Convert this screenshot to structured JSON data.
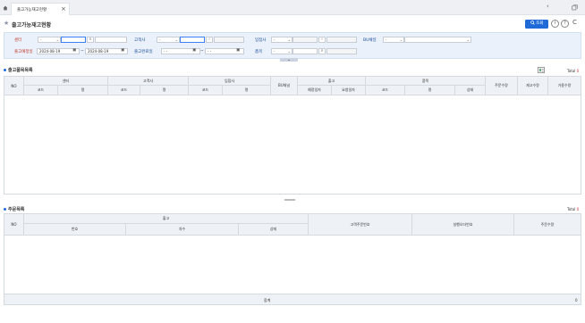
{
  "tabs": [
    {
      "label": "출고가능재고현황"
    }
  ],
  "page": {
    "title": "출고가능재고현황",
    "search_button": "조회",
    "info_icon": "i",
    "help_icon": "?",
    "refresh_icon": "C"
  },
  "search": {
    "center_label": "센터",
    "customer_label": "고객사",
    "owner_label": "입점사",
    "bu_channel_label": "BU채널",
    "ship_plan_date_label": "출고예정일",
    "ship_complete_date_label": "출고완료일",
    "item_label": "품목",
    "select_default": "-",
    "date_from": "2024-08-19",
    "date_to": "2024-08-19",
    "empty_date": "- -",
    "tilde": "~"
  },
  "upper": {
    "title": "출고품목목록",
    "total_label": "Total",
    "total_value": "0",
    "headers": {
      "no": "NO",
      "center": "센터",
      "customer": "고객사",
      "owner": "입점사",
      "bu_channel": "BU채널",
      "shipment": "출고",
      "item": "품목",
      "order_qty": "주문수량",
      "stock_qty": "재고수량",
      "available_qty": "가용수량",
      "code": "코드",
      "name": "명",
      "plan_date": "예정일자",
      "complete_date": "요청일자",
      "status": "상태"
    }
  },
  "lower": {
    "title": "주문목록",
    "total_label": "Total",
    "total_value": "0",
    "headers": {
      "no": "NO",
      "shipment": "출고",
      "number": "번호",
      "sequence": "차수",
      "status": "상태",
      "customer_order_no": "고객주문번호",
      "delivery_order_no": "실행오더번호",
      "order_qty": "주문수량"
    },
    "footer_label": "합계",
    "footer_value": "0"
  }
}
